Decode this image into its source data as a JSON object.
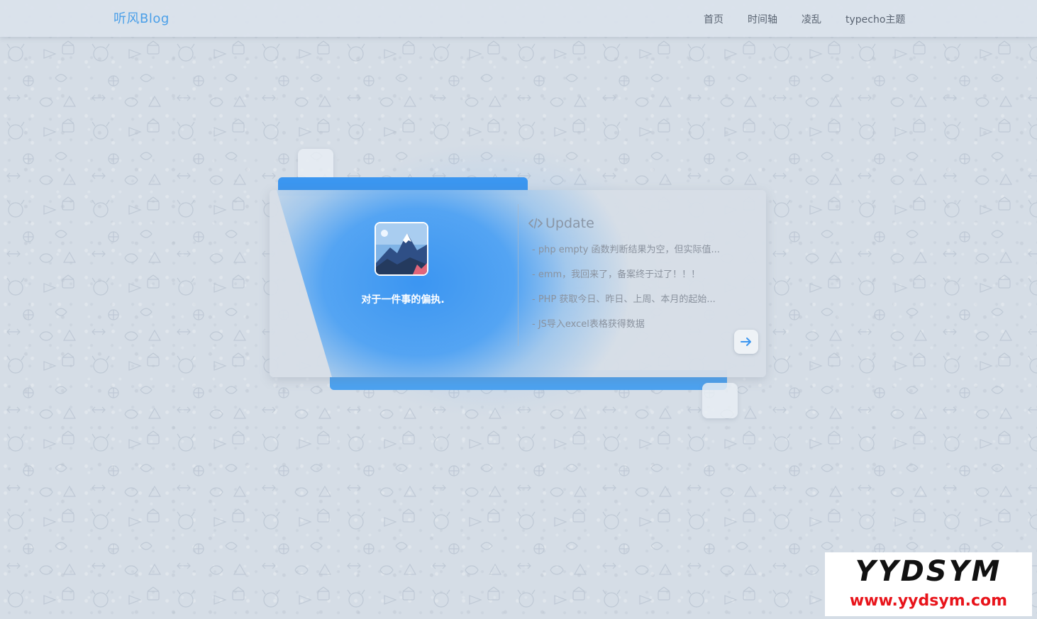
{
  "header": {
    "brand": "听风Blog",
    "nav": [
      {
        "label": "首页"
      },
      {
        "label": "时间轴"
      },
      {
        "label": "凌乱"
      },
      {
        "label": "typecho主题"
      }
    ]
  },
  "profile": {
    "motto": "对于一件事的偏执."
  },
  "updates": {
    "title": "Update",
    "posts": [
      {
        "label": "- php empty 函数判断结果为空，但实际值..."
      },
      {
        "label": "- emm，我回来了，备案终于过了！！！"
      },
      {
        "label": "- PHP 获取今日、昨日、上周、本月的起始..."
      },
      {
        "label": "- JS导入excel表格获得数据"
      }
    ]
  },
  "watermark": {
    "logo": "YYDSYM",
    "url": "www.yydsym.com"
  },
  "colors": {
    "accent": "#3b96f0",
    "brand": "#4a9fe8",
    "background": "#d5dde6",
    "watermark_red": "#e8141b"
  },
  "icons": {
    "update": "code-icon",
    "more": "arrow-right-icon"
  }
}
